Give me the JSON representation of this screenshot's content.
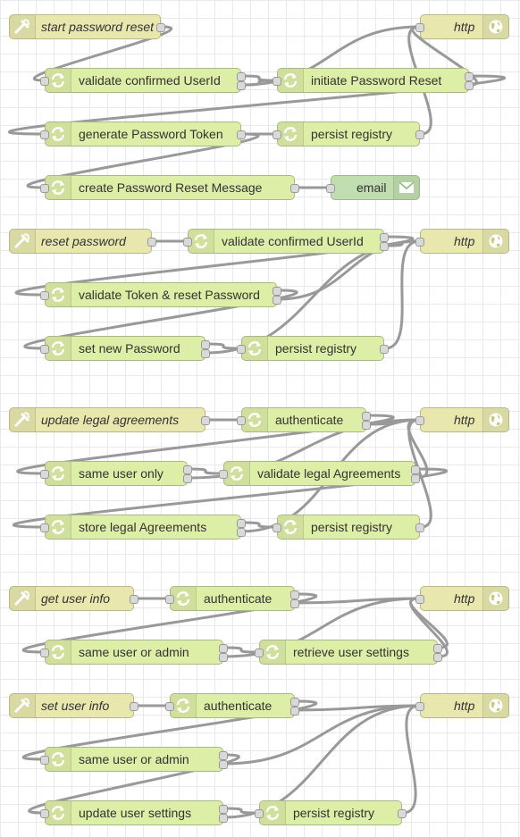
{
  "flows": [
    {
      "nodes": [
        {
          "id": "n1",
          "type": "inject",
          "label": "start password reset",
          "icon": "inject-icon"
        },
        {
          "id": "n2",
          "type": "function",
          "label": "validate confirmed UserId",
          "icon": "function-icon"
        },
        {
          "id": "n3",
          "type": "function",
          "label": "initiate Password Reset",
          "icon": "function-icon"
        },
        {
          "id": "n4",
          "type": "http",
          "label": "http",
          "icon": "globe-icon"
        },
        {
          "id": "n5",
          "type": "function",
          "label": "generate Password Token",
          "icon": "function-icon"
        },
        {
          "id": "n6",
          "type": "function",
          "label": "persist registry",
          "icon": "function-icon"
        },
        {
          "id": "n7",
          "type": "function",
          "label": "create Password Reset Message",
          "icon": "function-icon"
        },
        {
          "id": "n8",
          "type": "email",
          "label": "email",
          "icon": "envelope-icon"
        }
      ]
    },
    {
      "nodes": [
        {
          "id": "r1",
          "type": "inject",
          "label": "reset password",
          "icon": "inject-icon"
        },
        {
          "id": "r2",
          "type": "function",
          "label": "validate confirmed UserId",
          "icon": "function-icon"
        },
        {
          "id": "r3",
          "type": "http",
          "label": "http",
          "icon": "globe-icon"
        },
        {
          "id": "r4",
          "type": "function",
          "label": "validate Token & reset Password",
          "icon": "function-icon"
        },
        {
          "id": "r5",
          "type": "function",
          "label": "set new Password",
          "icon": "function-icon"
        },
        {
          "id": "r6",
          "type": "function",
          "label": "persist registry",
          "icon": "function-icon"
        }
      ]
    },
    {
      "nodes": [
        {
          "id": "u1",
          "type": "inject",
          "label": "update legal agreements",
          "icon": "inject-icon"
        },
        {
          "id": "u2",
          "type": "function",
          "label": "authenticate",
          "icon": "function-icon"
        },
        {
          "id": "u3",
          "type": "http",
          "label": "http",
          "icon": "globe-icon"
        },
        {
          "id": "u4",
          "type": "function",
          "label": "same user only",
          "icon": "function-icon"
        },
        {
          "id": "u5",
          "type": "function",
          "label": "validate legal Agreements",
          "icon": "function-icon"
        },
        {
          "id": "u6",
          "type": "function",
          "label": "store legal Agreements",
          "icon": "function-icon"
        },
        {
          "id": "u7",
          "type": "function",
          "label": "persist registry",
          "icon": "function-icon"
        }
      ]
    },
    {
      "nodes": [
        {
          "id": "g1",
          "type": "inject",
          "label": "get user info",
          "icon": "inject-icon"
        },
        {
          "id": "g2",
          "type": "function",
          "label": "authenticate",
          "icon": "function-icon"
        },
        {
          "id": "g3",
          "type": "http",
          "label": "http",
          "icon": "globe-icon"
        },
        {
          "id": "g4",
          "type": "function",
          "label": "same user or admin",
          "icon": "function-icon"
        },
        {
          "id": "g5",
          "type": "function",
          "label": "retrieve user settings",
          "icon": "function-icon"
        }
      ]
    },
    {
      "nodes": [
        {
          "id": "s1",
          "type": "inject",
          "label": "set user info",
          "icon": "inject-icon"
        },
        {
          "id": "s2",
          "type": "function",
          "label": "authenticate",
          "icon": "function-icon"
        },
        {
          "id": "s3",
          "type": "http",
          "label": "http",
          "icon": "globe-icon"
        },
        {
          "id": "s4",
          "type": "function",
          "label": "same user or admin",
          "icon": "function-icon"
        },
        {
          "id": "s5",
          "type": "function",
          "label": "update user settings",
          "icon": "function-icon"
        },
        {
          "id": "s6",
          "type": "function",
          "label": "persist registry",
          "icon": "function-icon"
        }
      ]
    }
  ],
  "colors": {
    "inject": "#e7e7ae",
    "function": "#ddeea6",
    "email": "#c0deaf",
    "wire": "#999999"
  }
}
